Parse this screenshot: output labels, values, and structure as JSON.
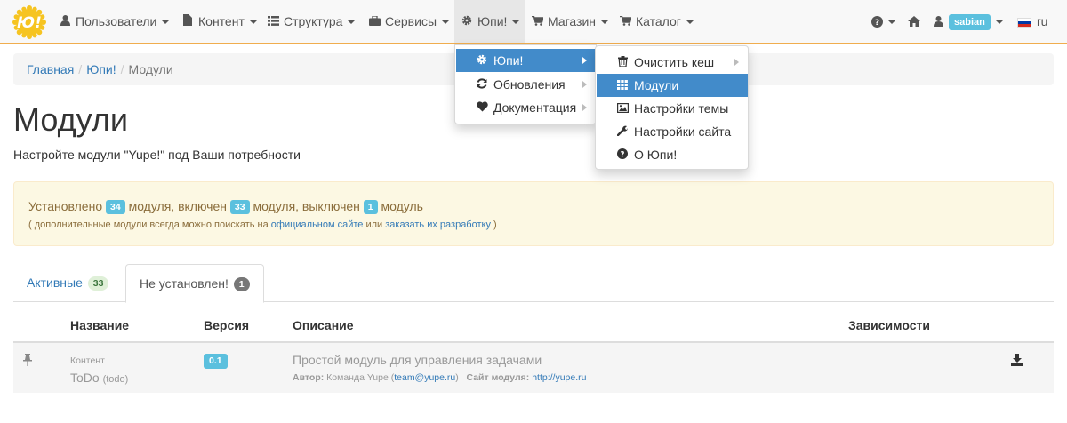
{
  "navbar": {
    "items": [
      {
        "label": "Пользователи",
        "icon": "user-icon"
      },
      {
        "label": "Контент",
        "icon": "file-icon"
      },
      {
        "label": "Структура",
        "icon": "list-icon"
      },
      {
        "label": "Сервисы",
        "icon": "briefcase-icon"
      },
      {
        "label": "Юпи!",
        "icon": "gear-icon"
      },
      {
        "label": "Магазин",
        "icon": "cart-icon"
      },
      {
        "label": "Каталог",
        "icon": "cart-icon"
      }
    ],
    "username": "sabian",
    "language": "ru"
  },
  "yupi_menu": {
    "items": [
      {
        "label": "Юпи!",
        "icon": "gear-icon"
      },
      {
        "label": "Обновления",
        "icon": "refresh-icon"
      },
      {
        "label": "Документация",
        "icon": "heart-icon"
      }
    ]
  },
  "yupi_submenu": {
    "items": [
      {
        "label": "Очистить кеш",
        "icon": "trash-icon"
      },
      {
        "label": "Модули",
        "icon": "grid-icon"
      },
      {
        "label": "Настройки темы",
        "icon": "picture-icon"
      },
      {
        "label": "Настройки сайта",
        "icon": "wrench-icon"
      },
      {
        "label": "О Юпи!",
        "icon": "question-icon"
      }
    ]
  },
  "breadcrumb": {
    "home": "Главная",
    "parent": "Юпи!",
    "current": "Модули"
  },
  "page": {
    "title": "Модули",
    "subtitle": "Настройте модули \"Yupe!\" под Ваши потребности"
  },
  "alert": {
    "installed_prefix": "Установлено",
    "installed_count": "34",
    "enabled_prefix": "модуля, включен",
    "enabled_count": "33",
    "disabled_prefix": "модуля, выключен",
    "disabled_count": "1",
    "suffix": "модуль",
    "hint_open": "( дополнительные модули всегда можно поискать на",
    "hint_link1": "официальном сайте",
    "hint_or": "или",
    "hint_link2": "заказать их разработку",
    "hint_close": ")"
  },
  "tabs": [
    {
      "label": "Активные",
      "count": "33"
    },
    {
      "label": "Не установлен!",
      "count": "1"
    }
  ],
  "table": {
    "headers": {
      "name": "Название",
      "version": "Версия",
      "description": "Описание",
      "dependencies": "Зависимости"
    },
    "rows": [
      {
        "category": "Контент",
        "name": "ToDo",
        "id": "(todo)",
        "version": "0.1",
        "description": "Простой модуль для управления задачами",
        "author_label": "Автор:",
        "author": "Команда Yupe",
        "email": "team@yupe.ru",
        "site_label": "Сайт модуля:",
        "site": "http://yupe.ru"
      }
    ]
  },
  "colors": {
    "accent": "#f0ad4e",
    "link": "#337ab7",
    "menu_selected": "#428bca",
    "label_info": "#5bc0de"
  }
}
